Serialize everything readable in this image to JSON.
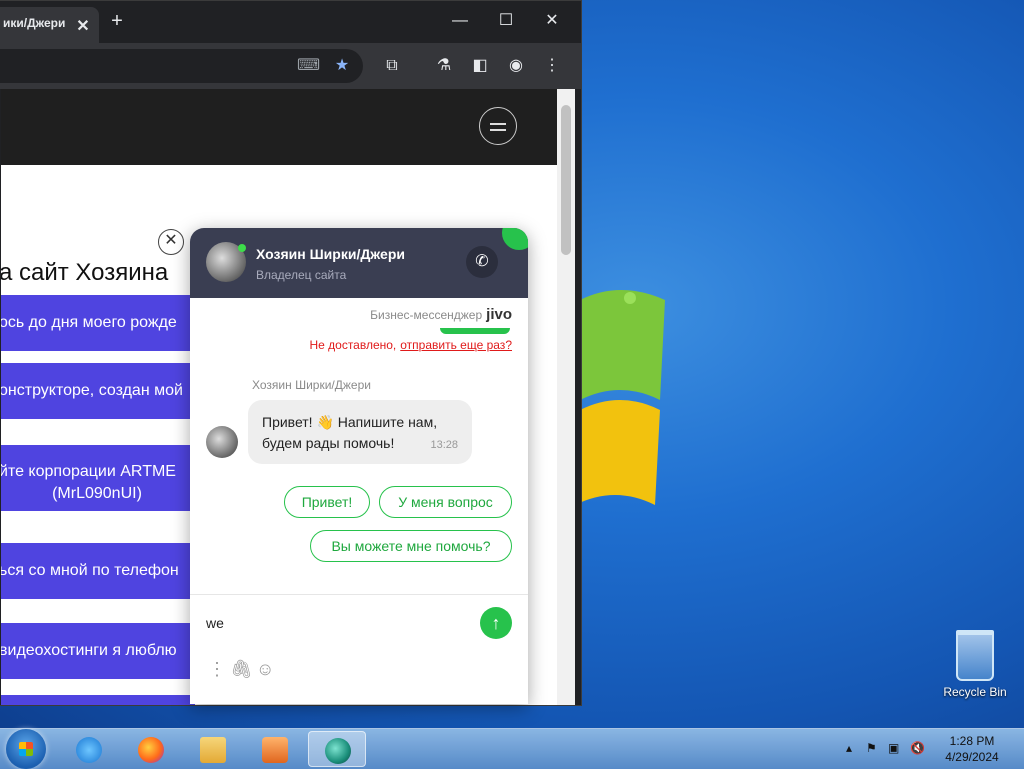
{
  "browser": {
    "tab_title": "ики/Джери",
    "tab_close": "✕",
    "new_tab": "+",
    "window_controls": {
      "minimize": "—",
      "maximize": "☐",
      "close": "✕"
    },
    "toolbar_icons": [
      "translate-icon",
      "bookmark-star-icon",
      "extensions-icon",
      "labs-icon",
      "sidepanel-icon",
      "profile-icon",
      "more-icon"
    ]
  },
  "page": {
    "title": "а сайт Хозяина",
    "buttons": [
      "ось до дня моего рожде",
      "онструкторе, создан мой",
      "йте корпорации ARTME",
      "(MrL090nUI)",
      "ься со мной по телефон",
      "видеохостинги я люблю"
    ]
  },
  "chat": {
    "name": "Хозяин Ширки/Джери",
    "subtitle": "Владелец сайта",
    "brand_label": "Бизнес-мессенджер",
    "brand_logo": "jivo",
    "undelivered": "Не доставлено,",
    "resend": "отправить еще раз?",
    "sender": "Хозяин Ширки/Джери",
    "message_line1": "Привет! 👋 Напишите нам,",
    "message_line2": "будем рады помочь!",
    "message_time": "13:28",
    "quick_replies": [
      "Привет!",
      "У меня вопрос",
      "Вы можете мне помочь?"
    ],
    "input_value": "we",
    "send_icon": "↑",
    "close_widget": "✕"
  },
  "desktop": {
    "recycle_bin": "Recycle Bin"
  },
  "taskbar": {
    "time": "1:28 PM",
    "date": "4/29/2024"
  }
}
